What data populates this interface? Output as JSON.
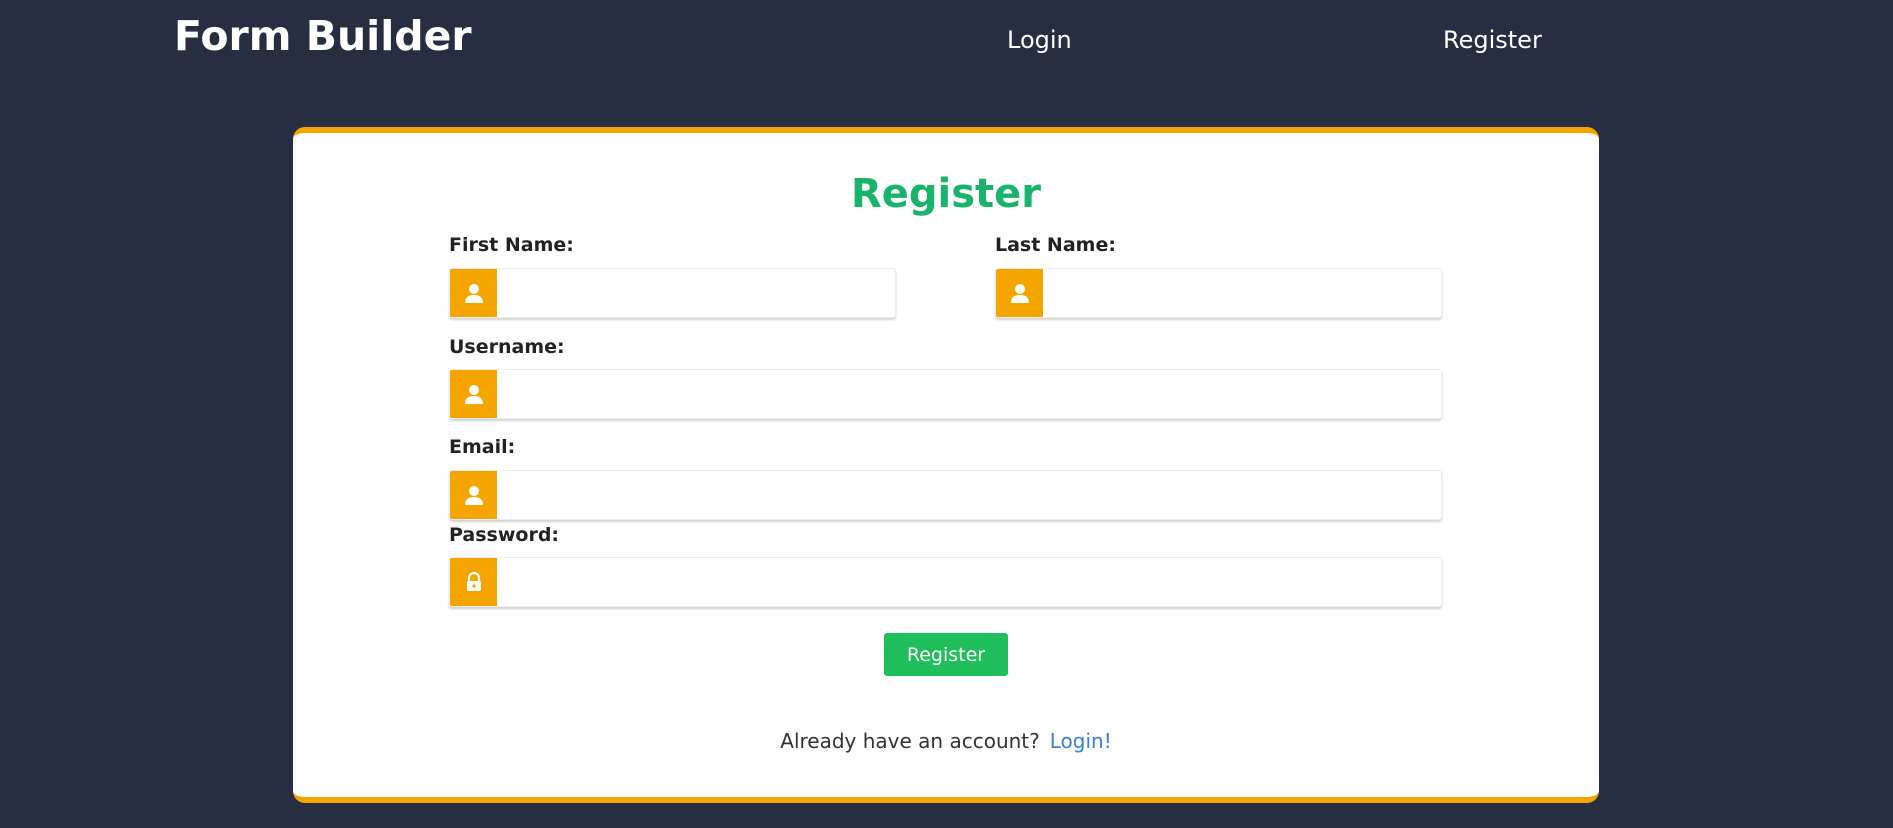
{
  "navbar": {
    "brand": "Form Builder",
    "login_label": "Login",
    "register_label": "Register"
  },
  "form": {
    "title": "Register",
    "fields": {
      "first_name": {
        "label": "First Name:",
        "value": "",
        "icon": "user-icon"
      },
      "last_name": {
        "label": "Last Name:",
        "value": "",
        "icon": "user-icon"
      },
      "username": {
        "label": "Username:",
        "value": "",
        "icon": "user-icon"
      },
      "email": {
        "label": "Email:",
        "value": "",
        "icon": "user-icon"
      },
      "password": {
        "label": "Password:",
        "value": "",
        "icon": "lock-icon"
      }
    },
    "submit_label": "Register",
    "footer_text": "Already have an account?",
    "footer_link": "Login!"
  },
  "colors": {
    "background": "#272e42",
    "accent": "#f5a500",
    "title_green": "#19b36c",
    "button_green": "#1fbf5b",
    "link_blue": "#3b7fd4"
  }
}
